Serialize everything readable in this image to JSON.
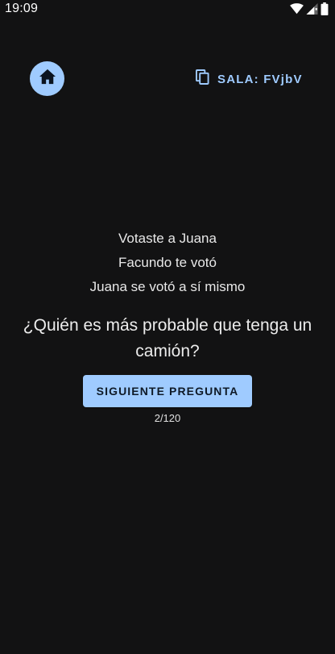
{
  "status_bar": {
    "time": "19:09",
    "icons": [
      "wifi-icon",
      "signal-icon",
      "battery-icon"
    ]
  },
  "header": {
    "home_icon": "home-icon",
    "room_icon": "copy-icon",
    "room_label": "SALA: FVjbV"
  },
  "results": {
    "lines": [
      "Votaste a Juana",
      "Facundo te votó",
      "Juana se votó a sí mismo"
    ]
  },
  "question": "¿Quién es más probable que tenga un camión?",
  "next_button_label": "SIGUIENTE PREGUNTA",
  "counter": "2/120",
  "colors": {
    "background": "#121213",
    "accent": "#9fcbff",
    "text": "#e6e6e6"
  }
}
